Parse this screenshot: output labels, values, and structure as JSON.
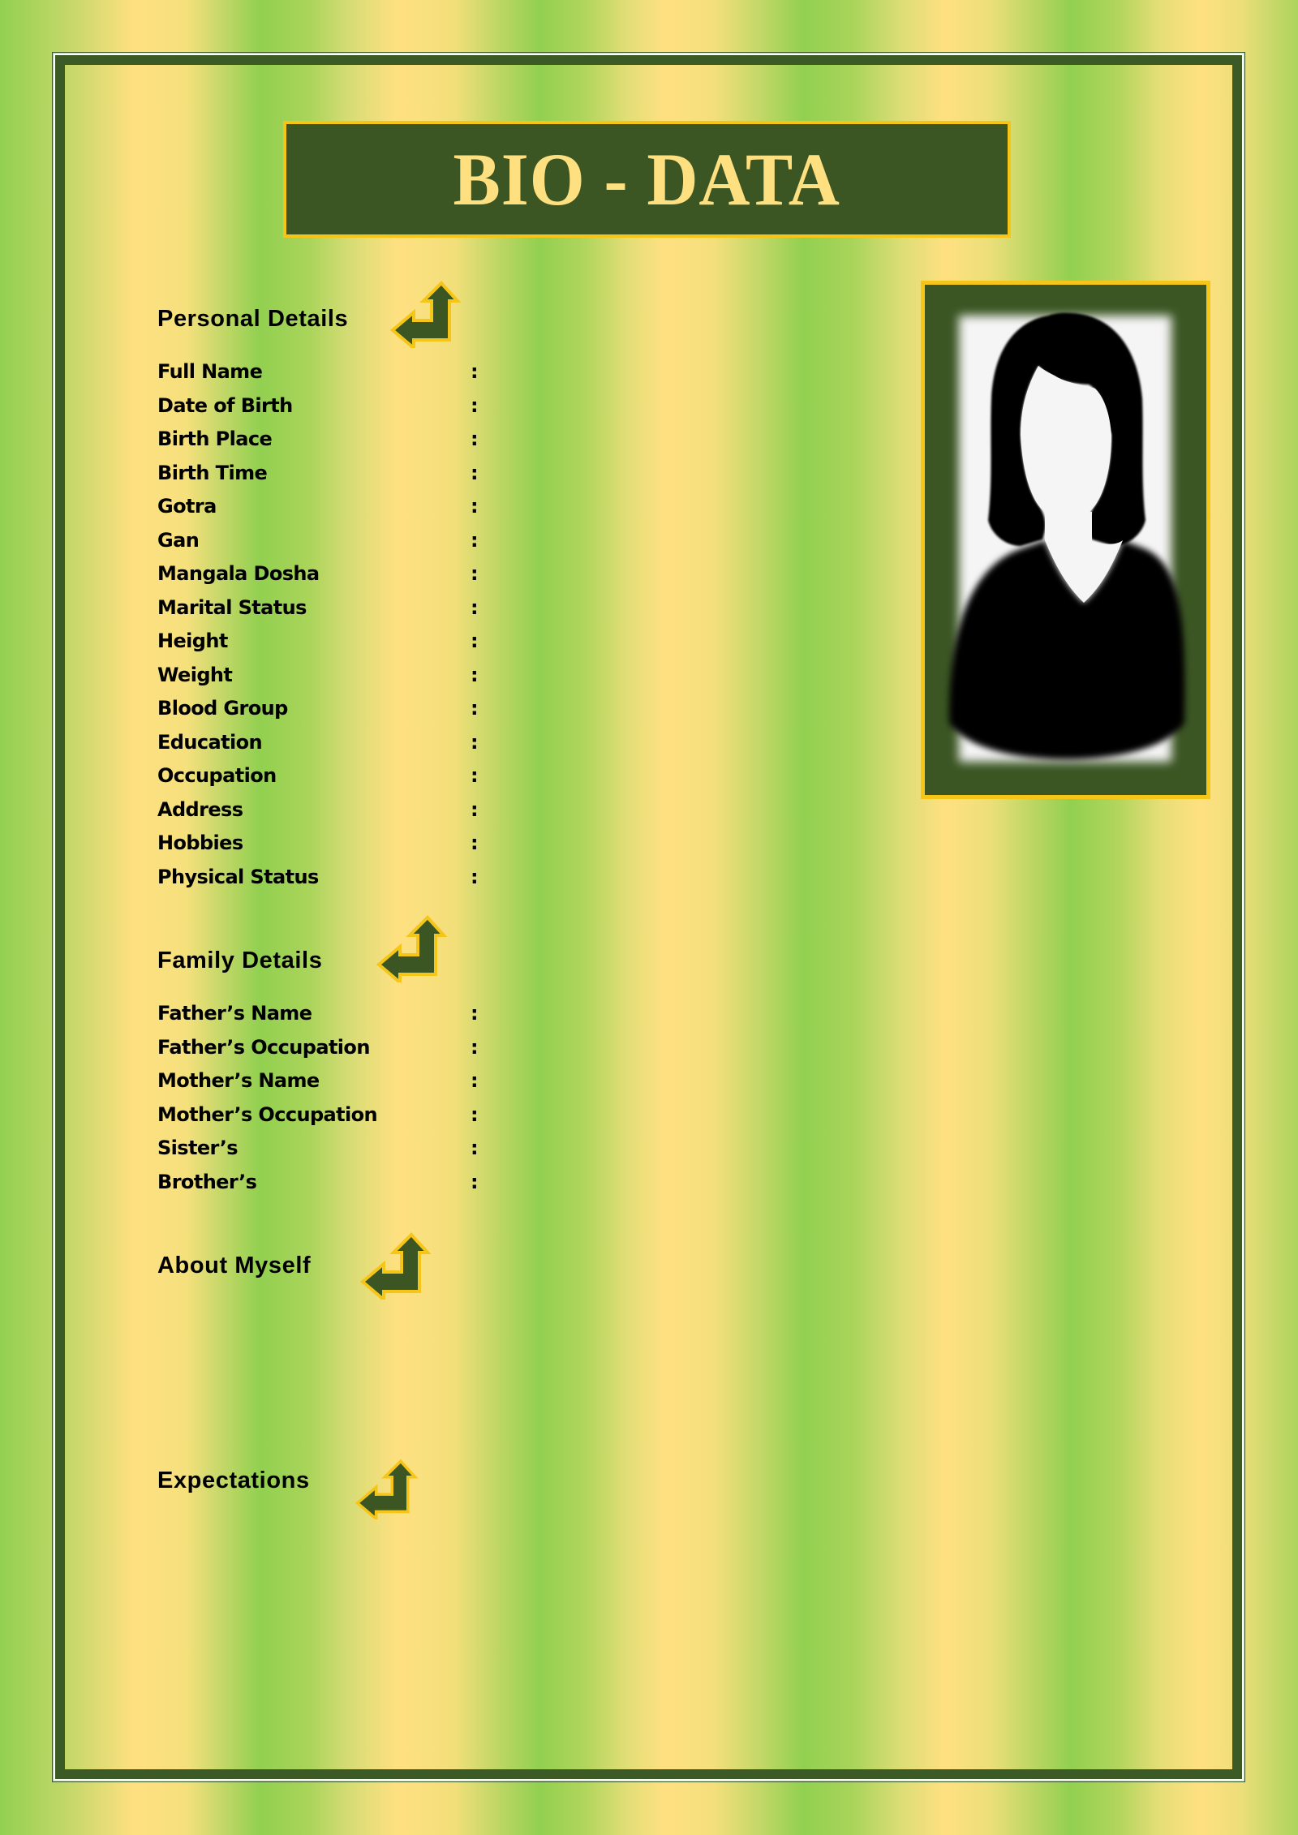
{
  "document": {
    "title": "BIO - DATA"
  },
  "colors": {
    "dark_green": "#3b5523",
    "gold": "#f5c518",
    "title_text": "#ffe081",
    "stripe_green": "#92d050",
    "stripe_yellow": "#ffe081"
  },
  "photo": {
    "icon": "female-avatar-placeholder-icon"
  },
  "sections": {
    "personal": {
      "heading": "Personal Details",
      "icon": "bent-arrow-icon",
      "fields": [
        {
          "label": "Full Name",
          "separator": ":",
          "value": ""
        },
        {
          "label": "Date of Birth",
          "separator": ":",
          "value": ""
        },
        {
          "label": "Birth Place",
          "separator": ":",
          "value": ""
        },
        {
          "label": "Birth Time",
          "separator": ":",
          "value": ""
        },
        {
          "label": "Gotra",
          "separator": ":",
          "value": ""
        },
        {
          "label": "Gan",
          "separator": ":",
          "value": ""
        },
        {
          "label": "Mangala Dosha",
          "separator": ":",
          "value": ""
        },
        {
          "label": "Marital Status",
          "separator": ":",
          "value": ""
        },
        {
          "label": "Height",
          "separator": ":",
          "value": ""
        },
        {
          "label": "Weight",
          "separator": ":",
          "value": ""
        },
        {
          "label": "Blood Group",
          "separator": ":",
          "value": ""
        },
        {
          "label": "Education",
          "separator": ":",
          "value": ""
        },
        {
          "label": "Occupation",
          "separator": ":",
          "value": ""
        },
        {
          "label": "Address",
          "separator": ":",
          "value": ""
        },
        {
          "label": "Hobbies",
          "separator": ":",
          "value": ""
        },
        {
          "label": "Physical Status",
          "separator": ":",
          "value": ""
        }
      ]
    },
    "family": {
      "heading": "Family Details",
      "icon": "bent-arrow-icon",
      "fields": [
        {
          "label": "Father’s Name",
          "separator": ":",
          "value": ""
        },
        {
          "label": "Father’s Occupation",
          "separator": ":",
          "value": ""
        },
        {
          "label": "Mother’s Name",
          "separator": ":",
          "value": ""
        },
        {
          "label": "Mother’s Occupation",
          "separator": ":",
          "value": ""
        },
        {
          "label": "Sister’s",
          "separator": ":",
          "value": ""
        },
        {
          "label": "Brother’s",
          "separator": ":",
          "value": ""
        }
      ]
    },
    "about": {
      "heading": "About Myself",
      "icon": "bent-arrow-icon",
      "content": ""
    },
    "expectations": {
      "heading": "Expectations",
      "icon": "bent-arrow-icon",
      "content": ""
    }
  }
}
